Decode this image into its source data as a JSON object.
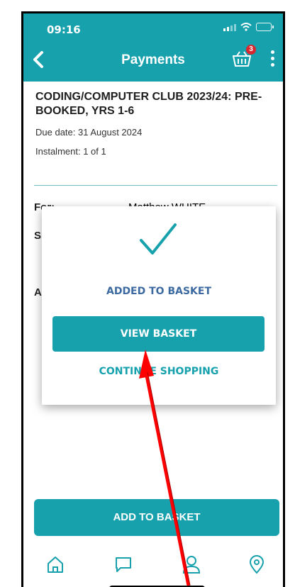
{
  "status_bar": {
    "time": "09:16"
  },
  "header": {
    "title": "Payments",
    "basket_count": "3"
  },
  "item": {
    "title": "CODING/COMPUTER CLUB 2023/24: PRE-BOOKED, YRS 1-6",
    "due_date": "Due date: 31 August 2024",
    "instalment": "Instalment: 1 of 1"
  },
  "details": {
    "for_label": "For:",
    "for_value": "Matthew WHITE",
    "partial_s": "S",
    "partial_a": "A"
  },
  "modal": {
    "added_label": "ADDED TO BASKET",
    "view_basket_label": "VIEW BASKET",
    "continue_label": "CONTINUE SHOPPING"
  },
  "actions": {
    "add_to_basket_label": "ADD TO BASKET"
  },
  "tabbar": {
    "icons": [
      "home-icon",
      "message-icon",
      "profile-icon",
      "location-icon"
    ]
  },
  "colors": {
    "brand": "#17a1ad",
    "badge": "#d8272e",
    "annotation_arrow": "#ff0000",
    "added_text": "#3c6aa0"
  }
}
